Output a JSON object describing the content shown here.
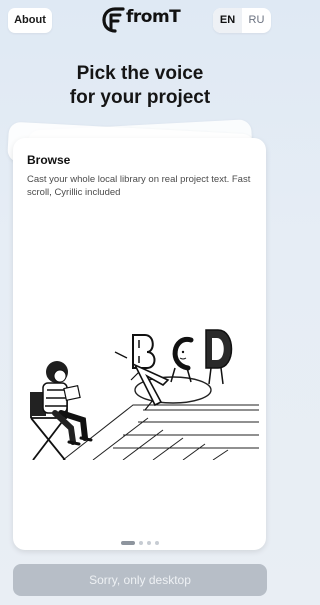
{
  "header": {
    "about_label": "About",
    "logo_text": "fromT",
    "languages": [
      {
        "code": "EN",
        "active": true
      },
      {
        "code": "RU",
        "active": false
      }
    ]
  },
  "headline": {
    "line1": "Pick the voice",
    "line2": "for your project"
  },
  "carousel": {
    "card": {
      "title": "Browse",
      "description": "Cast your whole local library on real project text. Fast scroll, Cyrillic included",
      "illustration": "director-chair-reading-letters-illustration"
    },
    "pages": 4,
    "active_page": 1
  },
  "footer": {
    "button_label": "Sorry, only desktop"
  },
  "colors": {
    "background": "#e3ebf4",
    "card": "#ffffff",
    "button_disabled": "#b7bec7",
    "text": "#151515"
  }
}
